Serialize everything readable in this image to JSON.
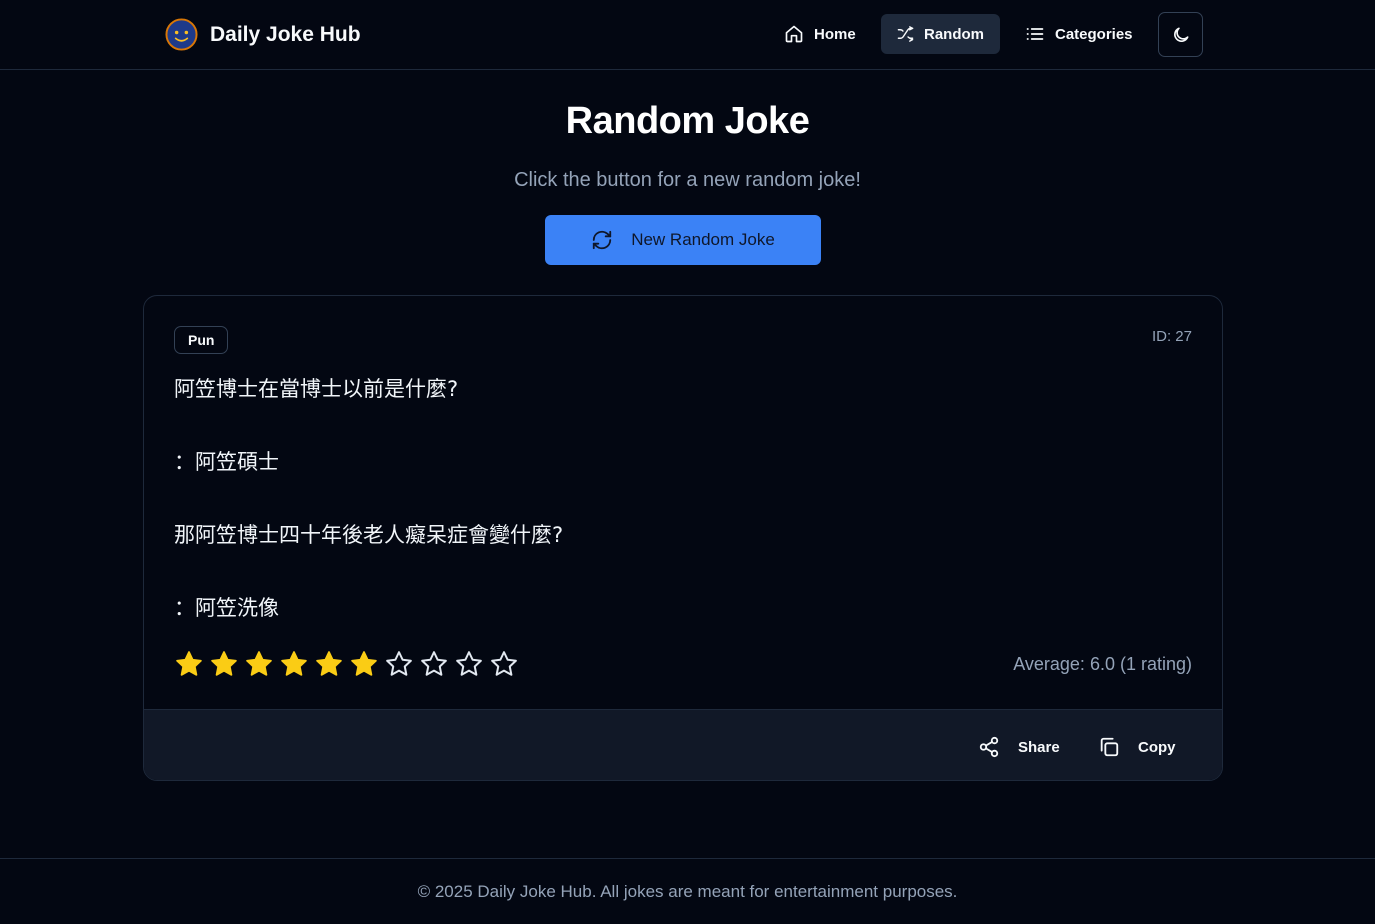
{
  "navbar": {
    "logo_icon": "smiley-face-logo",
    "brand": "Daily Joke Hub",
    "links": [
      {
        "label": "Home",
        "icon": "home-icon",
        "active": false
      },
      {
        "label": "Random",
        "icon": "shuffle-icon",
        "active": true
      },
      {
        "label": "Categories",
        "icon": "list-icon",
        "active": false
      }
    ],
    "theme_toggle_icon": "moon-icon"
  },
  "header": {
    "title": "Random Joke",
    "subtitle": "Click the button for a new random joke!",
    "button_label": "New Random Joke",
    "button_icon": "refresh-icon"
  },
  "joke": {
    "category": "Pun",
    "id_label": "ID: 27",
    "lines": [
      "阿笠博士在當博士以前是什麼?",
      "：阿笠碩士",
      "那阿笠博士四十年後老人癡呆症會變什麼?",
      "：阿笠洗像"
    ],
    "rating": {
      "max": 10,
      "value": 6,
      "average_text": "Average: 6.0 (1 rating)"
    },
    "actions": {
      "share_label": "Share",
      "copy_label": "Copy"
    }
  },
  "footer": {
    "text": "© 2025 Daily Joke Hub. All jokes are meant for entertainment purposes."
  },
  "colors": {
    "background": "#030712",
    "accent": "#3b82f6",
    "star_filled": "#facc15",
    "muted_text": "#94a3b8",
    "border": "#1e293b"
  }
}
